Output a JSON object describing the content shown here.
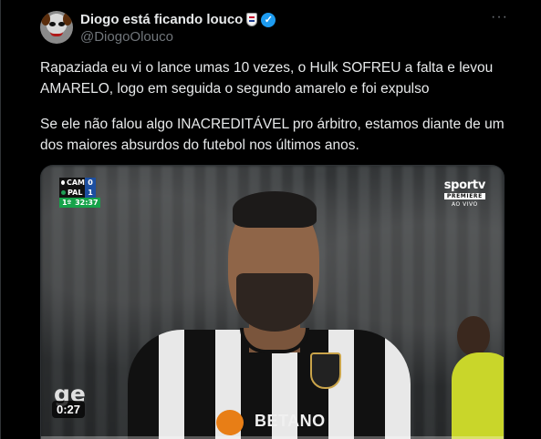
{
  "author": {
    "display_name": "Diogo está ficando louco",
    "handle": "@DiogoOlouco",
    "avatar_icon": "clown-avatar",
    "badge_icon": "club-badge-icon",
    "verified_icon": "verified-check-icon",
    "verified_glyph": "✓"
  },
  "tweet": {
    "paragraph_1": "Rapaziada eu vi o lance umas 10 vezes, o Hulk SOFREU a falta e levou AMARELO, logo em seguida o segundo amarelo e foi expulso",
    "paragraph_2": "Se ele não falou algo INACREDITÁVEL pro árbitro, estamos diante de um dos maiores absurdos do futebol nos últimos anos.",
    "more_glyph": "···"
  },
  "video": {
    "timecode": "0:27",
    "watermark": "ge",
    "scoreboard": {
      "home_team": "CAM",
      "home_score": "0",
      "away_team": "PAL",
      "away_score": "1",
      "period": "1º",
      "clock": "32:37"
    },
    "broadcaster": {
      "logo": "sportv",
      "sub": "PREMIERE",
      "live": "AO VIVO"
    },
    "sponsor": "BETANO",
    "progress": 0.0
  }
}
